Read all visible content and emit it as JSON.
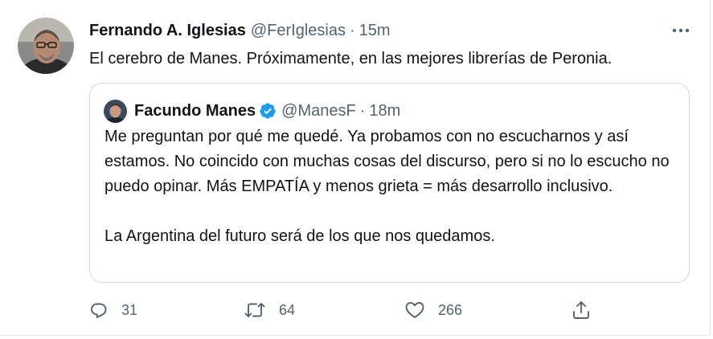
{
  "tweet": {
    "author_name": "Fernando A. Iglesias",
    "author_handle": "@FerIglesias",
    "separator": "·",
    "time": "15m",
    "text": "El cerebro de Manes. Próximamente, en las mejores librerías de Peronia.",
    "more_icon": "more-horizontal-icon"
  },
  "quoted": {
    "author_name": "Facundo Manes",
    "verified": true,
    "author_handle": "@ManesF",
    "separator": "·",
    "time": "18m",
    "paragraph1": "Me preguntan por qué me quedé. Ya probamos con no escucharnos y así estamos. No coincido con muchas cosas del discurso, pero si no lo escucho no puedo opinar. Más EMPATÍA y menos grieta = más desarrollo inclusivo.",
    "paragraph2": "La Argentina del futuro será de los que nos quedamos."
  },
  "actions": {
    "replies": "31",
    "retweets": "64",
    "likes": "266"
  },
  "colors": {
    "text": "#0f1419",
    "secondary": "#536471",
    "border": "#cfd9de",
    "verified": "#1d9bf0"
  }
}
